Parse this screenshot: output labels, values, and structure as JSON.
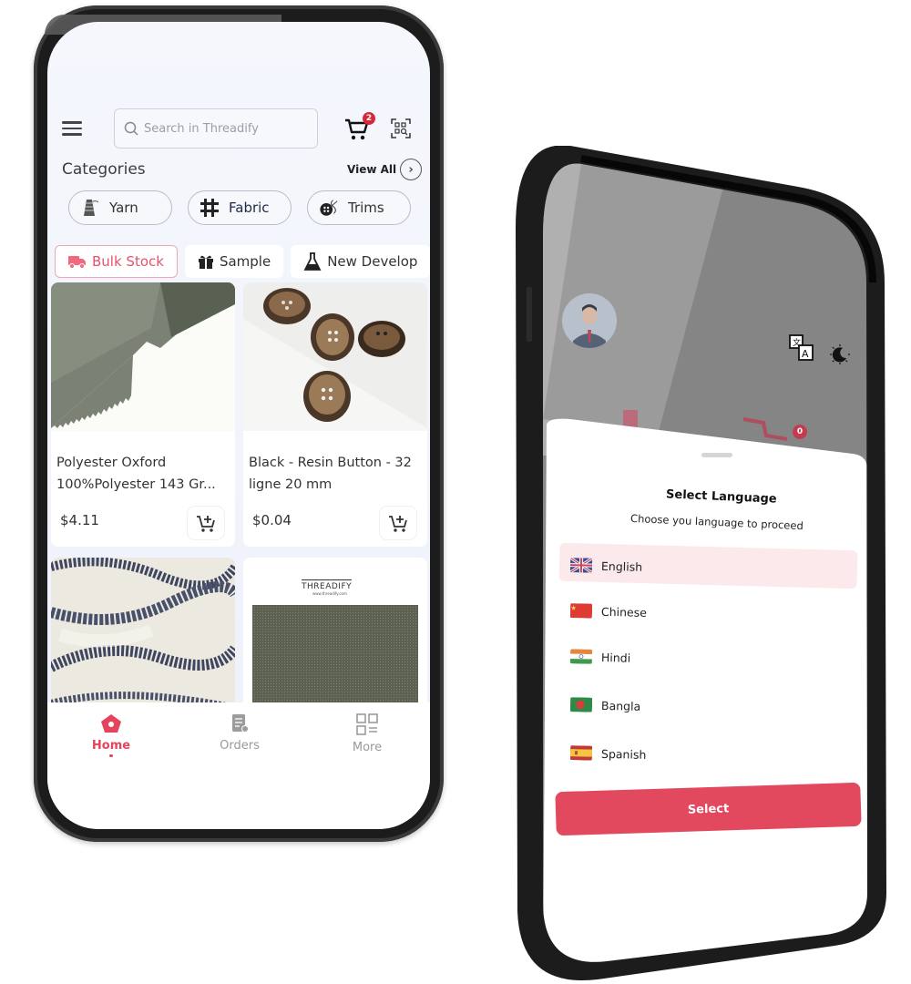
{
  "left_phone": {
    "header": {
      "search_placeholder": "Search in Threadify",
      "cart_count": "2"
    },
    "categories": {
      "title": "Categories",
      "view_all": "View All",
      "items": [
        {
          "label": "Yarn",
          "icon": "yarn-spool-icon"
        },
        {
          "label": "Fabric",
          "icon": "fabric-weave-icon"
        },
        {
          "label": "Trims",
          "icon": "button-needle-icon"
        }
      ]
    },
    "tabs": [
      {
        "label": "Bulk Stock",
        "icon": "truck-icon",
        "active": true
      },
      {
        "label": "Sample",
        "icon": "gift-icon",
        "active": false
      },
      {
        "label": "New Develop",
        "icon": "flask-icon",
        "active": false
      }
    ],
    "products": [
      {
        "name": "Polyester Oxford 100%Polyester 143 Gr...",
        "price": "$4.11",
        "image": "green-oxford-fabric"
      },
      {
        "name": "Black - Resin Button - 32 ligne 20 mm",
        "price": "$0.04",
        "image": "brown-resin-buttons"
      },
      {
        "name": "",
        "price": "",
        "image": "white-blue-knit-fabric"
      },
      {
        "name": "",
        "price": "",
        "image": "threadify-olive-swatch",
        "swatch_brand": "THREADIFY",
        "swatch_url": "www.threadify.com"
      }
    ],
    "bottom_nav": [
      {
        "label": "Home",
        "icon": "home-icon",
        "active": true
      },
      {
        "label": "Orders",
        "icon": "orders-icon",
        "active": false
      },
      {
        "label": "More",
        "icon": "more-grid-icon",
        "active": false
      }
    ]
  },
  "right_phone": {
    "background": {
      "cart_count": "0"
    },
    "language_sheet": {
      "title": "Select Language",
      "subtitle": "Choose you language to proceed",
      "languages": [
        {
          "label": "English",
          "flag": "uk-flag",
          "selected": true
        },
        {
          "label": "Chinese",
          "flag": "china-flag",
          "selected": false
        },
        {
          "label": "Hindi",
          "flag": "india-flag",
          "selected": false
        },
        {
          "label": "Bangla",
          "flag": "bangladesh-flag",
          "selected": false
        },
        {
          "label": "Spanish",
          "flag": "spain-flag",
          "selected": false
        }
      ],
      "select_button": "Select"
    }
  },
  "colors": {
    "accent": "#e2485e",
    "selected_row": "#fbe9ec",
    "badge": "#d7283a"
  }
}
